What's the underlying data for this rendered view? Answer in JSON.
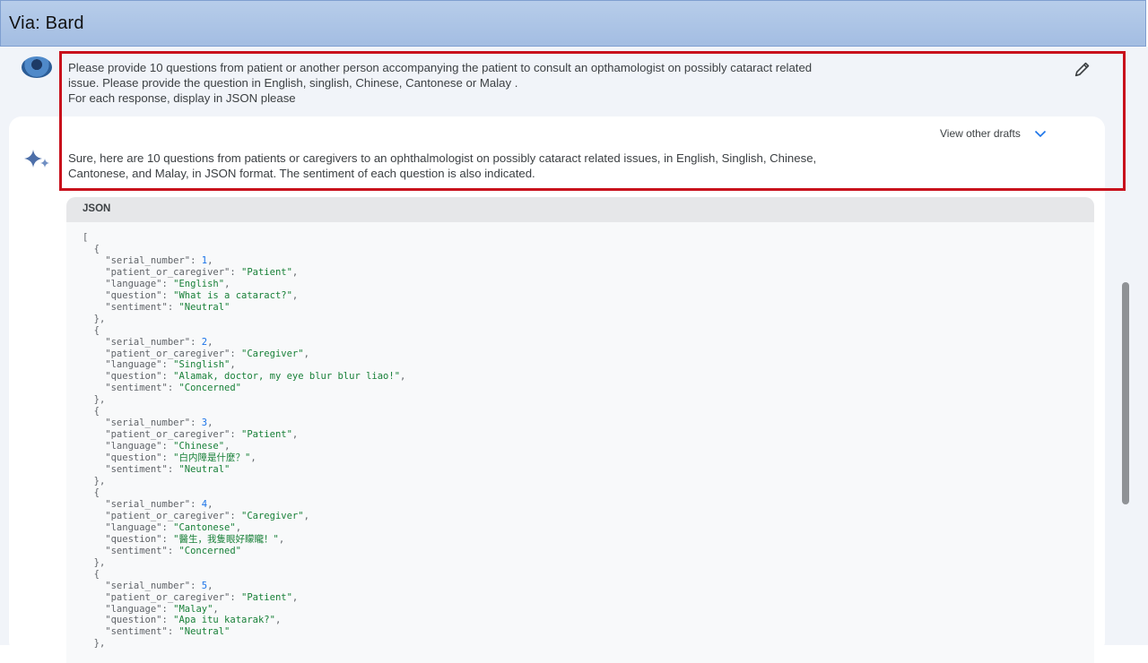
{
  "window": {
    "title": "Via: Bard"
  },
  "prompt": {
    "lines": [
      "Please provide 10 questions from patient or another person accompanying the patient to consult an opthamologist on possibly cataract related",
      "issue. Please provide the question in English, singlish, Chinese, Cantonese or Malay .",
      "For each response, display in JSON please"
    ]
  },
  "response": {
    "drafts_label": "View other drafts",
    "lines": [
      "Sure, here are 10 questions from patients or caregivers to an ophthalmologist on possibly cataract related issues, in English, Singlish, Chinese,",
      "Cantonese, and Malay, in JSON format. The sentiment of each question is also indicated."
    ]
  },
  "code_block": {
    "label": "JSON",
    "entries": [
      {
        "serial_number": "1",
        "patient_or_caregiver": "Patient",
        "language": "English",
        "question": "What is a cataract?",
        "sentiment": "Neutral"
      },
      {
        "serial_number": "2",
        "patient_or_caregiver": "Caregiver",
        "language": "Singlish",
        "question": "Alamak, doctor, my eye blur blur liao!",
        "sentiment": "Concerned"
      },
      {
        "serial_number": "3",
        "patient_or_caregiver": "Patient",
        "language": "Chinese",
        "question": "白内障是什麼？",
        "sentiment": "Neutral"
      },
      {
        "serial_number": "4",
        "patient_or_caregiver": "Caregiver",
        "language": "Cantonese",
        "question": "醫生，我隻眼好矇矓！",
        "sentiment": "Concerned"
      },
      {
        "serial_number": "5",
        "patient_or_caregiver": "Patient",
        "language": "Malay",
        "question": "Apa itu katarak?",
        "sentiment": "Neutral"
      }
    ]
  },
  "colors": {
    "highlight_border": "#c8101c",
    "title_bar": "#a3bde2",
    "code_string": "#188038"
  },
  "icons": {
    "avatar": "user-avatar",
    "edit": "pencil-icon",
    "expand": "chevron-down-icon",
    "assistant": "sparkle-icon"
  }
}
